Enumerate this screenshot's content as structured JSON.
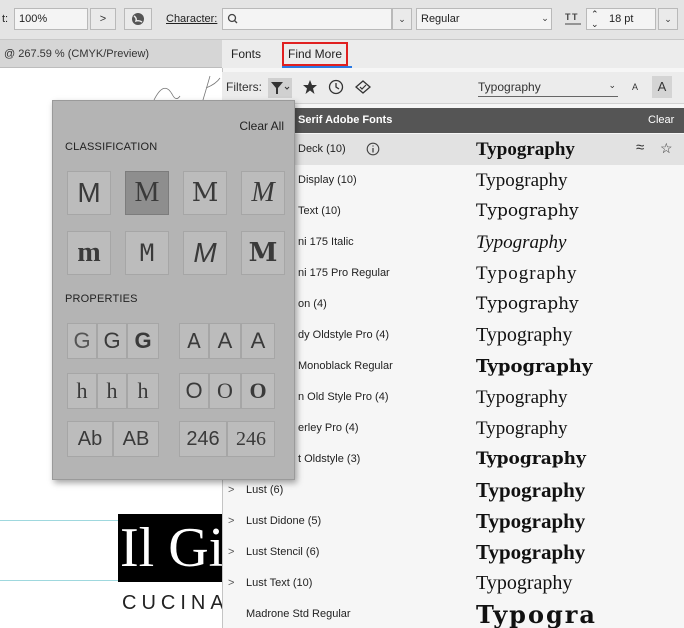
{
  "topbar": {
    "zoom_prefix": "t:",
    "zoom_value": "100%",
    "zoom_arrow": ">",
    "character_label": "Character:",
    "font_search_value": "",
    "font_style": "Regular",
    "font_size": "18 pt"
  },
  "document": {
    "tab_label": "@ 267.59 % (CMYK/Preview)"
  },
  "canvas": {
    "logo_text": "Il Gi",
    "cucina_text": "CUCINA"
  },
  "classification_popup": {
    "clear_all": "Clear All",
    "classification_heading": "CLASSIFICATION",
    "properties_heading": "PROPERTIES",
    "classification_tiles": [
      "M",
      "M",
      "M",
      "M",
      "m",
      "M",
      "M",
      "M"
    ],
    "property_weight_tiles": [
      "G",
      "G",
      "G",
      "A",
      "A",
      "A"
    ],
    "property_width_tiles": [
      "h",
      "h",
      "h",
      "O",
      "O",
      "O"
    ],
    "property_case_tiles": [
      "Ab",
      "AB",
      "246",
      "246"
    ]
  },
  "font_panel": {
    "tabs": {
      "fonts": "Fonts",
      "find_more": "Find More"
    },
    "filters_label": "Filters:",
    "sample_dropdown": "Typography",
    "size_small": "A",
    "size_large": "A",
    "section_header": "Serif Adobe Fonts",
    "section_header_right": "Clear",
    "rows": [
      {
        "name": "Deck (10)",
        "sample": "Typography",
        "chevron": ""
      },
      {
        "name": "Display (10)",
        "sample": "Typography",
        "chevron": ""
      },
      {
        "name": "Text (10)",
        "sample": "Typography",
        "chevron": ""
      },
      {
        "name": "ni 175 Italic",
        "sample": "Typography",
        "chevron": ""
      },
      {
        "name": "ni 175 Pro Regular",
        "sample": "Typography",
        "chevron": ""
      },
      {
        "name": "on (4)",
        "sample": "Typography",
        "chevron": ""
      },
      {
        "name": "dy Oldstyle Pro (4)",
        "sample": "Typography",
        "chevron": ""
      },
      {
        "name": "Monoblack Regular",
        "sample": "Typography",
        "chevron": ""
      },
      {
        "name": "n Old Style Pro (4)",
        "sample": "Typography",
        "chevron": ""
      },
      {
        "name": "erley Pro (4)",
        "sample": "Typography",
        "chevron": ""
      },
      {
        "name": "t Oldstyle (3)",
        "sample": "Typography",
        "chevron": ""
      },
      {
        "name": "Lust (6)",
        "sample": "Typography",
        "chevron": ">"
      },
      {
        "name": "Lust Didone (5)",
        "sample": "Typography",
        "chevron": ">"
      },
      {
        "name": "Lust Stencil (6)",
        "sample": "Typography",
        "chevron": ">"
      },
      {
        "name": "Lust Text (10)",
        "sample": "Typography",
        "chevron": ">"
      },
      {
        "name": "Madrone Std Regular",
        "sample": "Typogra",
        "chevron": ""
      }
    ]
  },
  "colors": {
    "accent_underline": "#2a7ae4",
    "find_more_outline": "#e02020",
    "popup_bg": "#b4b4b4",
    "tile_selected": "#8e8e8e"
  },
  "icons": [
    "chevron-right-icon",
    "globe-icon",
    "search-icon",
    "dropdown-icon",
    "filter-icon",
    "star-icon",
    "clock-icon",
    "cloud-sync-icon",
    "info-icon",
    "similar-icon",
    "favorite-icon"
  ]
}
